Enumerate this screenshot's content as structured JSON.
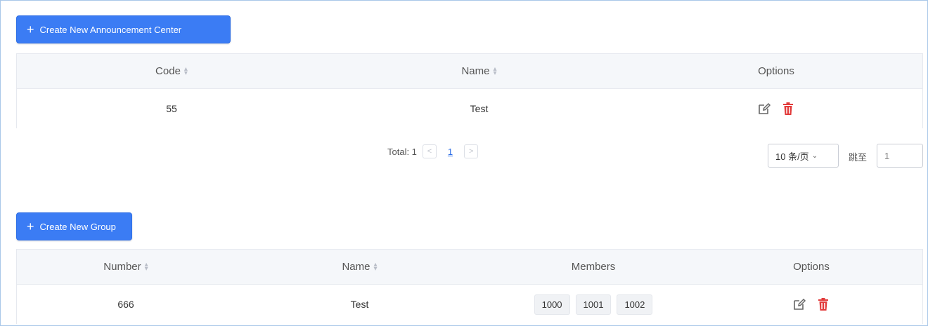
{
  "announcement": {
    "create_button": "Create New Announcement Center",
    "columns": {
      "code": "Code",
      "name": "Name",
      "options": "Options"
    },
    "rows": [
      {
        "code": "55",
        "name": "Test"
      }
    ],
    "pagination": {
      "total_label": "Total: 1",
      "current_page": "1",
      "page_size": "10 条/页",
      "jump_label": "跳至",
      "jump_value": "1"
    }
  },
  "group": {
    "create_button": "Create New Group",
    "columns": {
      "number": "Number",
      "name": "Name",
      "members": "Members",
      "options": "Options"
    },
    "rows": [
      {
        "number": "666",
        "name": "Test",
        "members": [
          "1000",
          "1001",
          "1002"
        ]
      }
    ]
  },
  "icons": {
    "edit": "edit-icon",
    "delete": "trash-icon"
  },
  "colors": {
    "primary": "#3b7cf4",
    "delete": "#e23b3b",
    "header_bg": "#f5f7fa",
    "link": "#2f6fe6"
  }
}
